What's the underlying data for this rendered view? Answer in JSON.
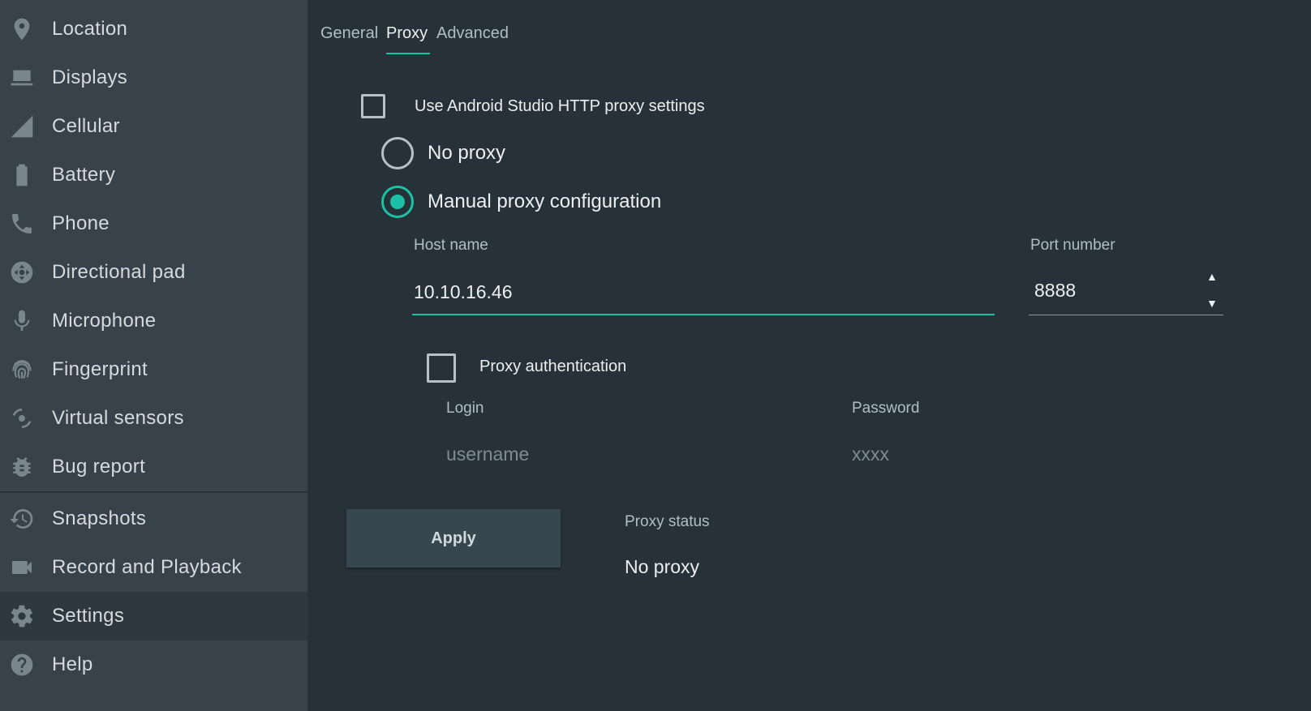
{
  "sidebar": {
    "items": [
      {
        "label": "Location",
        "icon": "location-pin-icon"
      },
      {
        "label": "Displays",
        "icon": "display-icon"
      },
      {
        "label": "Cellular",
        "icon": "cellular-signal-icon"
      },
      {
        "label": "Battery",
        "icon": "battery-icon"
      },
      {
        "label": "Phone",
        "icon": "phone-icon"
      },
      {
        "label": "Directional pad",
        "icon": "dpad-icon"
      },
      {
        "label": "Microphone",
        "icon": "microphone-icon"
      },
      {
        "label": "Fingerprint",
        "icon": "fingerprint-icon"
      },
      {
        "label": "Virtual sensors",
        "icon": "virtual-sensors-icon"
      },
      {
        "label": "Bug report",
        "icon": "bug-icon"
      },
      {
        "label": "Snapshots",
        "icon": "history-icon"
      },
      {
        "label": "Record and Playback",
        "icon": "video-camera-icon"
      },
      {
        "label": "Settings",
        "icon": "gear-icon"
      },
      {
        "label": "Help",
        "icon": "help-icon"
      }
    ],
    "active_item": "Settings"
  },
  "tabs": [
    {
      "label": "General"
    },
    {
      "label": "Proxy"
    },
    {
      "label": "Advanced"
    }
  ],
  "active_tab": "Proxy",
  "proxy": {
    "use_studio_label": "Use Android Studio HTTP proxy settings",
    "use_studio_checked": false,
    "no_proxy_label": "No proxy",
    "manual_label": "Manual proxy configuration",
    "selected_mode": "Manual proxy configuration",
    "host_label": "Host name",
    "host_value": "10.10.16.46",
    "port_label": "Port number",
    "port_value": "8888",
    "auth_label": "Proxy authentication",
    "auth_checked": false,
    "login_label": "Login",
    "login_placeholder": "username",
    "password_label": "Password",
    "password_placeholder": "xxxx",
    "apply_label": "Apply",
    "status_label": "Proxy status",
    "status_value": "No proxy"
  },
  "colors": {
    "accent": "#1dbfa6",
    "background": "#263238",
    "sidebar": "#37424a"
  }
}
